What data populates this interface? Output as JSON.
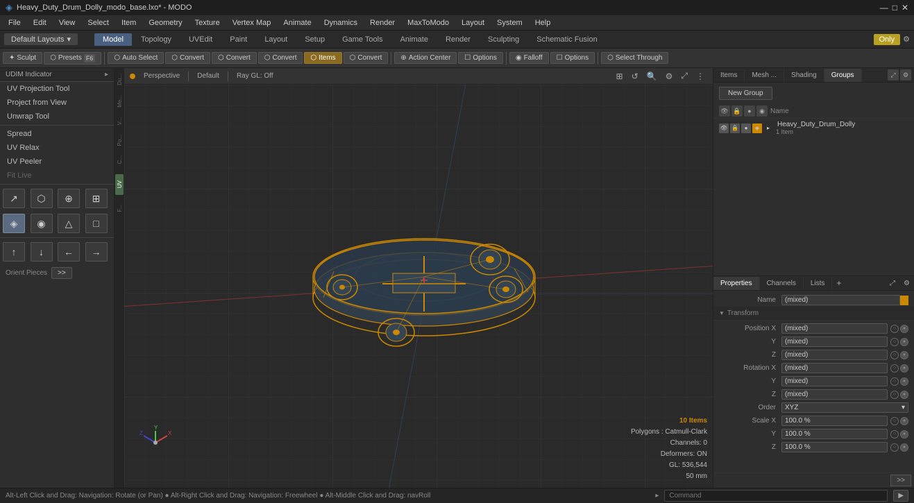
{
  "window": {
    "title": "Heavy_Duty_Drum_Dolly_modo_base.lxo* - MODO",
    "controls": [
      "—",
      "□",
      "✕"
    ]
  },
  "menu": {
    "items": [
      "File",
      "Edit",
      "View",
      "Select",
      "Item",
      "Geometry",
      "Texture",
      "Vertex Map",
      "Animate",
      "Dynamics",
      "Render",
      "MaxToModo",
      "Layout",
      "System",
      "Help"
    ]
  },
  "layout_bar": {
    "default_label": "Default Layouts",
    "dropdown_icon": "▾",
    "tabs": [
      "Model",
      "Topology",
      "UVEdit",
      "Paint",
      "Layout",
      "Setup",
      "Game Tools",
      "Animate",
      "Render",
      "Sculpting",
      "Schematic Fusion"
    ],
    "active_tab": "Model",
    "only_label": "Only",
    "gear_icon": "⚙"
  },
  "toolbar": {
    "sculpt_label": "Sculpt",
    "presets_label": "Presets",
    "f6_label": "F6",
    "auto_select": "Auto Select",
    "convert1": "Convert",
    "convert2": "Convert",
    "convert3": "Convert",
    "convert4": "Convert",
    "items_label": "Items",
    "action_center": "Action Center",
    "options1": "Options",
    "falloff": "Falloff",
    "options2": "Options",
    "select_through": "Select Through"
  },
  "left_panel": {
    "tools": [
      "UDIM Indicator",
      "UV Projection Tool",
      "Project from View",
      "Unwrap Tool",
      "Spread",
      "UV Relax",
      "UV Peeler",
      "Fit Live",
      "Orient Pieces"
    ],
    "orient_pieces_label": "Orient Pieces",
    "uv_label": "UV"
  },
  "viewport": {
    "dot_color": "#cc8800",
    "perspective_label": "Perspective",
    "default_label": "Default",
    "ray_gl_label": "Ray GL: Off",
    "items_count": "10 Items",
    "polygons_label": "Polygons : Catmull-Clark",
    "channels_label": "Channels: 0",
    "deformers_label": "Deformers: ON",
    "gl_label": "GL: 536,544",
    "size_label": "50 mm"
  },
  "right_panel": {
    "top_tabs": [
      "Items",
      "Mesh ...",
      "Shading",
      "Groups"
    ],
    "active_top_tab": "Groups",
    "new_group_btn": "New Group",
    "name_col": "Name",
    "group_name": "Heavy_Duty_Drum_Dolly",
    "group_count": "1 Item",
    "bottom_tabs": [
      "Properties",
      "Channels",
      "Lists"
    ],
    "active_bottom_tab": "Properties",
    "add_icon": "+",
    "props": {
      "name_label": "Name",
      "name_value": "(mixed)",
      "transform_section": "Transform",
      "position_x_label": "Position X",
      "position_x_value": "(mixed)",
      "position_y_label": "Y",
      "position_y_value": "(mixed)",
      "position_z_label": "Z",
      "position_z_value": "(mixed)",
      "rotation_x_label": "Rotation X",
      "rotation_x_value": "(mixed)",
      "rotation_y_label": "Y",
      "rotation_y_value": "(mixed)",
      "rotation_z_label": "Z",
      "rotation_z_value": "(mixed)",
      "order_label": "Order",
      "order_value": "XYZ",
      "scale_x_label": "Scale X",
      "scale_x_value": "100.0 %",
      "scale_y_label": "Y",
      "scale_y_value": "100.0 %",
      "scale_z_label": "Z",
      "scale_z_value": "100.0 %"
    }
  },
  "status_bar": {
    "nav_hint": "Alt-Left Click and Drag: Navigation: Rotate (or Pan) ● Alt-Right Click and Drag: Navigation: Freewheel ● Alt-Middle Click and Drag: navRoll",
    "command_placeholder": "Command",
    "run_icon": "▶"
  }
}
